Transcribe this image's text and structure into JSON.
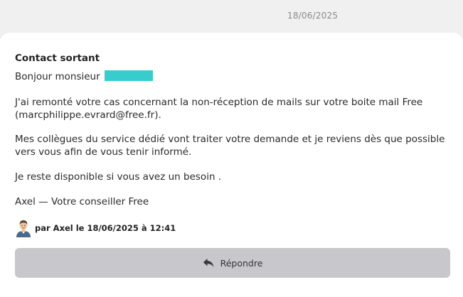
{
  "header": {
    "date": "18/06/2025"
  },
  "message": {
    "title": "Contact sortant",
    "greeting": "Bonjour monsieur",
    "paragraphs": [
      "J'ai remonté votre cas concernant la non-réception de mails sur votre boite mail Free (marcphilippe.evrard@free.fr).",
      "Mes collègues du service dédié vont traiter votre demande et je reviens dès que possible vers vous afin de vous tenir informé.",
      "Je reste disponible si vous avez un besoin ."
    ],
    "signature": "Axel — Votre conseiller Free",
    "author_line": "par Axel le 18/06/2025 à 12:41"
  },
  "actions": {
    "reply_label": "Répondre"
  },
  "colors": {
    "redaction": "#38cccc",
    "button_bg": "#c8c8cc"
  },
  "icons": {
    "avatar": "advisor-avatar-icon",
    "reply": "reply-arrow-icon"
  }
}
